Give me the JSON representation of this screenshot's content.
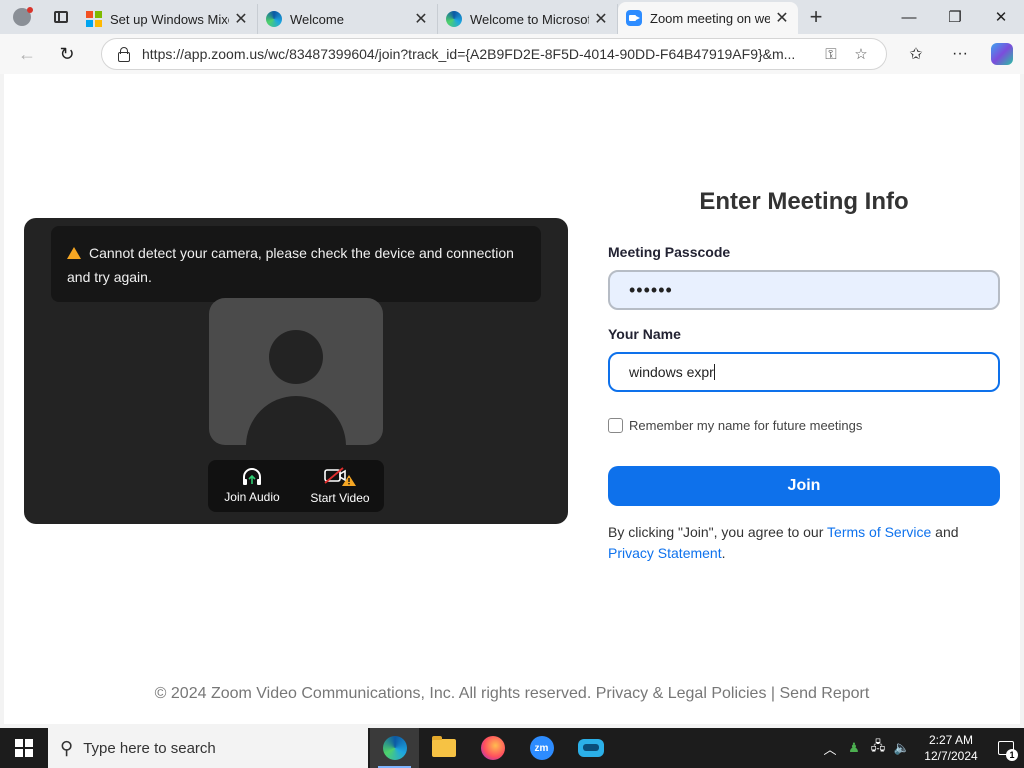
{
  "browser": {
    "tabs": [
      {
        "title": "Set up Windows Mixed",
        "icon": "microsoft-icon",
        "active": false
      },
      {
        "title": "Welcome",
        "icon": "edge-icon",
        "active": false
      },
      {
        "title": "Welcome to Microsoft",
        "icon": "edge-icon",
        "active": false
      },
      {
        "title": "Zoom meeting on web",
        "icon": "zoom-icon",
        "active": true
      }
    ],
    "url": "https://app.zoom.us/wc/83487399604/join?track_id={A2B9FD2E-8F5D-4014-90DD-F64B47919AF9}&m..."
  },
  "preview": {
    "warning": "Cannot detect your camera, please check the device and connection and try again.",
    "join_audio": "Join Audio",
    "start_video": "Start Video"
  },
  "form": {
    "title": "Enter Meeting Info",
    "passcode_label": "Meeting Passcode",
    "passcode_value": "••••••",
    "name_label": "Your Name",
    "name_value": "windows expr",
    "remember_label": "Remember my name for future meetings",
    "join_label": "Join",
    "agree_prefix": "By clicking \"Join\", you agree to our ",
    "terms_link": "Terms of Service",
    "agree_and": " and",
    "privacy_link": "Privacy Statement",
    "agree_suffix": "."
  },
  "footer": {
    "text": "© 2024 Zoom Video Communications, Inc. All rights reserved. Privacy & Legal Policies  |  Send Report"
  },
  "taskbar": {
    "search_placeholder": "Type here to search",
    "time": "2:27 AM",
    "date": "12/7/2024",
    "notification_count": "1",
    "zoom_app_label": "zm"
  }
}
